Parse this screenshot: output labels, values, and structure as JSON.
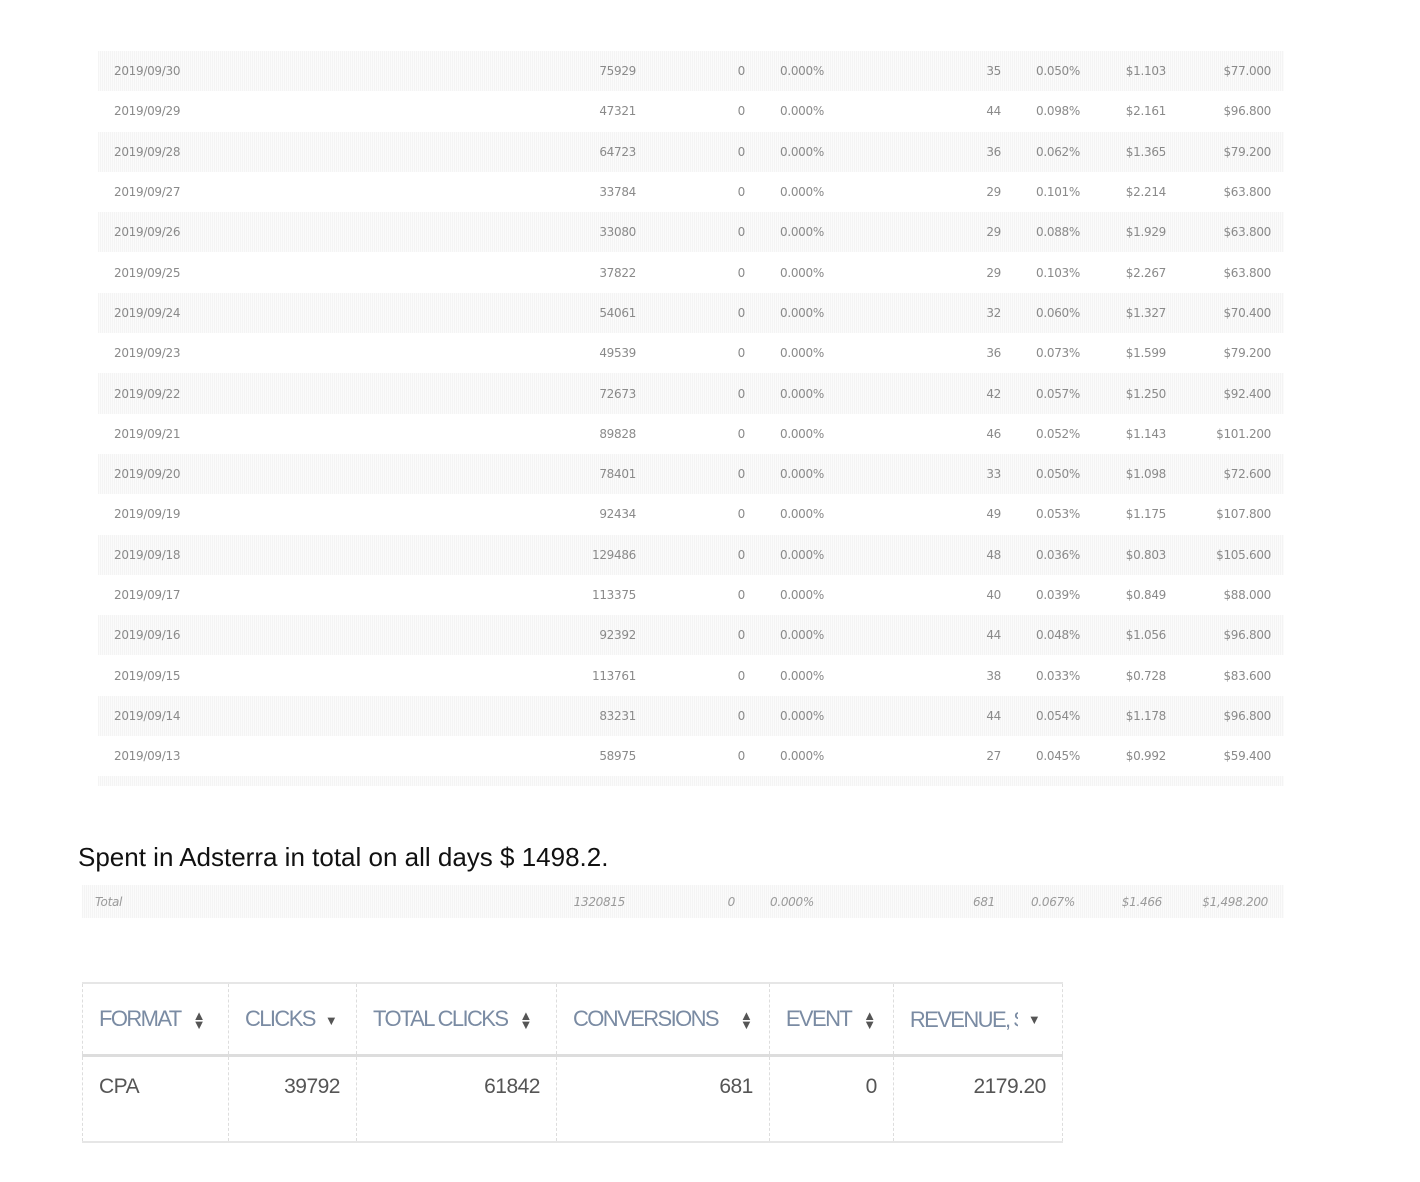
{
  "daily_rows": [
    {
      "date": "2019/09/30",
      "impressions": "75929",
      "clicks": "0",
      "click_rate": "0.000%",
      "conversions": "35",
      "ctr": "0.050%",
      "cpa": "$1.103",
      "spend": "$77.000"
    },
    {
      "date": "2019/09/29",
      "impressions": "47321",
      "clicks": "0",
      "click_rate": "0.000%",
      "conversions": "44",
      "ctr": "0.098%",
      "cpa": "$2.161",
      "spend": "$96.800"
    },
    {
      "date": "2019/09/28",
      "impressions": "64723",
      "clicks": "0",
      "click_rate": "0.000%",
      "conversions": "36",
      "ctr": "0.062%",
      "cpa": "$1.365",
      "spend": "$79.200"
    },
    {
      "date": "2019/09/27",
      "impressions": "33784",
      "clicks": "0",
      "click_rate": "0.000%",
      "conversions": "29",
      "ctr": "0.101%",
      "cpa": "$2.214",
      "spend": "$63.800"
    },
    {
      "date": "2019/09/26",
      "impressions": "33080",
      "clicks": "0",
      "click_rate": "0.000%",
      "conversions": "29",
      "ctr": "0.088%",
      "cpa": "$1.929",
      "spend": "$63.800"
    },
    {
      "date": "2019/09/25",
      "impressions": "37822",
      "clicks": "0",
      "click_rate": "0.000%",
      "conversions": "29",
      "ctr": "0.103%",
      "cpa": "$2.267",
      "spend": "$63.800"
    },
    {
      "date": "2019/09/24",
      "impressions": "54061",
      "clicks": "0",
      "click_rate": "0.000%",
      "conversions": "32",
      "ctr": "0.060%",
      "cpa": "$1.327",
      "spend": "$70.400"
    },
    {
      "date": "2019/09/23",
      "impressions": "49539",
      "clicks": "0",
      "click_rate": "0.000%",
      "conversions": "36",
      "ctr": "0.073%",
      "cpa": "$1.599",
      "spend": "$79.200"
    },
    {
      "date": "2019/09/22",
      "impressions": "72673",
      "clicks": "0",
      "click_rate": "0.000%",
      "conversions": "42",
      "ctr": "0.057%",
      "cpa": "$1.250",
      "spend": "$92.400"
    },
    {
      "date": "2019/09/21",
      "impressions": "89828",
      "clicks": "0",
      "click_rate": "0.000%",
      "conversions": "46",
      "ctr": "0.052%",
      "cpa": "$1.143",
      "spend": "$101.200"
    },
    {
      "date": "2019/09/20",
      "impressions": "78401",
      "clicks": "0",
      "click_rate": "0.000%",
      "conversions": "33",
      "ctr": "0.050%",
      "cpa": "$1.098",
      "spend": "$72.600"
    },
    {
      "date": "2019/09/19",
      "impressions": "92434",
      "clicks": "0",
      "click_rate": "0.000%",
      "conversions": "49",
      "ctr": "0.053%",
      "cpa": "$1.175",
      "spend": "$107.800"
    },
    {
      "date": "2019/09/18",
      "impressions": "129486",
      "clicks": "0",
      "click_rate": "0.000%",
      "conversions": "48",
      "ctr": "0.036%",
      "cpa": "$0.803",
      "spend": "$105.600"
    },
    {
      "date": "2019/09/17",
      "impressions": "113375",
      "clicks": "0",
      "click_rate": "0.000%",
      "conversions": "40",
      "ctr": "0.039%",
      "cpa": "$0.849",
      "spend": "$88.000"
    },
    {
      "date": "2019/09/16",
      "impressions": "92392",
      "clicks": "0",
      "click_rate": "0.000%",
      "conversions": "44",
      "ctr": "0.048%",
      "cpa": "$1.056",
      "spend": "$96.800"
    },
    {
      "date": "2019/09/15",
      "impressions": "113761",
      "clicks": "0",
      "click_rate": "0.000%",
      "conversions": "38",
      "ctr": "0.033%",
      "cpa": "$0.728",
      "spend": "$83.600"
    },
    {
      "date": "2019/09/14",
      "impressions": "83231",
      "clicks": "0",
      "click_rate": "0.000%",
      "conversions": "44",
      "ctr": "0.054%",
      "cpa": "$1.178",
      "spend": "$96.800"
    },
    {
      "date": "2019/09/13",
      "impressions": "58975",
      "clicks": "0",
      "click_rate": "0.000%",
      "conversions": "27",
      "ctr": "0.045%",
      "cpa": "$0.992",
      "spend": "$59.400"
    }
  ],
  "note": "Spent in Adsterra in total on all days $ 1498.2.",
  "total_row": {
    "label": "Total",
    "impressions": "1320815",
    "clicks": "0",
    "click_rate": "0.000%",
    "conversions": "681",
    "ctr": "0.067%",
    "cpa": "$1.466",
    "spend": "$1,498.200"
  },
  "format_table": {
    "headers": [
      {
        "label": "FORMAT",
        "sort": "both"
      },
      {
        "label": "CLICKS",
        "sort": "desc"
      },
      {
        "label": "TOTAL CLICKS",
        "sort": "both"
      },
      {
        "label": "CONVERSIONS",
        "sort": "both"
      },
      {
        "label": "EVENT",
        "sort": "both"
      },
      {
        "label": "REVENUE, $",
        "sort": "desc"
      }
    ],
    "row": {
      "format": "CPA",
      "clicks": "39792",
      "total_clicks": "61842",
      "conversions": "681",
      "event": "0",
      "revenue": "2179.20"
    }
  }
}
